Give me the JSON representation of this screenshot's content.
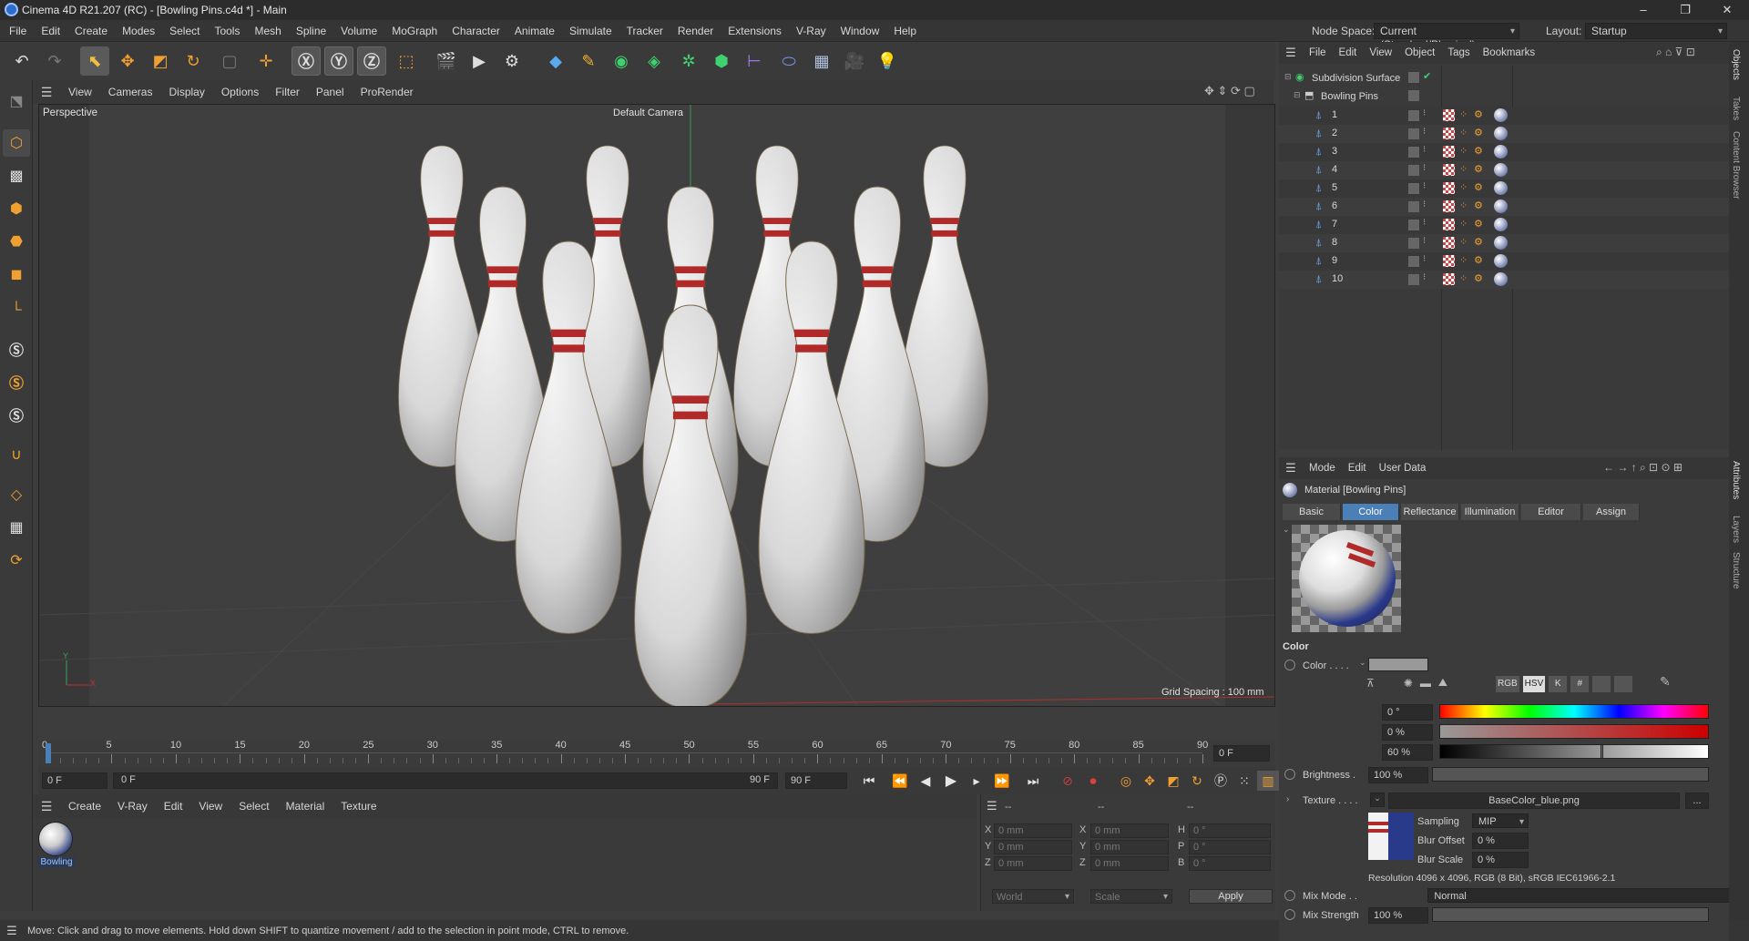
{
  "window": {
    "title": "Cinema 4D R21.207 (RC) - [Bowling Pins.c4d *] - Main",
    "controls": [
      "–",
      "❐",
      "✕"
    ]
  },
  "menubar": {
    "items": [
      "File",
      "Edit",
      "Create",
      "Modes",
      "Select",
      "Tools",
      "Mesh",
      "Spline",
      "Volume",
      "MoGraph",
      "Character",
      "Animate",
      "Simulate",
      "Tracker",
      "Render",
      "Extensions",
      "V-Ray",
      "Window",
      "Help"
    ],
    "node_space_label": "Node Space:",
    "node_space_value": "Current (Standard/Physical)",
    "layout_label": "Layout:",
    "layout_value": "Startup"
  },
  "viewport": {
    "menu": [
      "View",
      "Cameras",
      "Display",
      "Options",
      "Filter",
      "Panel",
      "ProRender"
    ],
    "label": "Perspective",
    "camera": "Default Camera",
    "grid_spacing": "Grid Spacing : 100 mm",
    "axis_y": "Y",
    "axis_x": "X"
  },
  "timeline": {
    "ticks": [
      "0",
      "5",
      "10",
      "15",
      "20",
      "25",
      "30",
      "35",
      "40",
      "45",
      "50",
      "55",
      "60",
      "65",
      "70",
      "75",
      "80",
      "85",
      "90"
    ],
    "current_frame": "0 F",
    "start": "0 F",
    "range_start": "0 F",
    "range_end": "90 F",
    "end": "90 F",
    "end_field": "90 F"
  },
  "material_manager": {
    "menu": [
      "Create",
      "V-Ray",
      "Edit",
      "View",
      "Select",
      "Material",
      "Texture"
    ],
    "materials": [
      {
        "name": "Bowling"
      }
    ]
  },
  "coordinates": {
    "header": [
      "--",
      "--",
      "--"
    ],
    "rows": [
      {
        "l1": "X",
        "v1": "0 mm",
        "l2": "X",
        "v2": "0 mm",
        "l3": "H",
        "v3": "0 °"
      },
      {
        "l1": "Y",
        "v1": "0 mm",
        "l2": "Y",
        "v2": "0 mm",
        "l3": "P",
        "v3": "0 °"
      },
      {
        "l1": "Z",
        "v1": "0 mm",
        "l2": "Z",
        "v2": "0 mm",
        "l3": "B",
        "v3": "0 °"
      }
    ],
    "world": "World",
    "scale": "Scale",
    "apply": "Apply"
  },
  "status": {
    "text": "Move: Click and drag to move elements. Hold down SHIFT to quantize movement / add to the selection in point mode, CTRL to remove."
  },
  "object_manager": {
    "menu": [
      "File",
      "Edit",
      "View",
      "Object",
      "Tags",
      "Bookmarks"
    ],
    "root": "Subdivision Surface",
    "group": "Bowling Pins",
    "children": [
      "1",
      "2",
      "3",
      "4",
      "5",
      "6",
      "7",
      "8",
      "9",
      "10"
    ]
  },
  "attribute_manager": {
    "menu": [
      "Mode",
      "Edit",
      "User Data"
    ],
    "title": "Material [Bowling Pins]",
    "tabs": [
      "Basic",
      "Color",
      "Reflectance",
      "Illumination",
      "Editor",
      "Assign"
    ],
    "active_tab": "Color",
    "section": "Color",
    "color_label": "Color . . . .",
    "h_label": "H",
    "h_value": "0 °",
    "s_label": "S",
    "s_value": "0 %",
    "v_label": "V",
    "v_value": "60 %",
    "v_level": 0.6,
    "brightness_label": "Brightness .",
    "brightness_value": "100 %",
    "texture_label": "Texture . . . .",
    "texture_file": "BaseColor_blue.png",
    "texture_more": "...",
    "sampling_label": "Sampling",
    "sampling_value": "MIP",
    "blur_offset_label": "Blur Offset",
    "blur_offset_value": "0 %",
    "blur_scale_label": "Blur Scale",
    "blur_scale_value": "0 %",
    "resolution": "Resolution 4096 x 4096, RGB (8 Bit), sRGB IEC61966-2.1",
    "mix_mode_label": "Mix Mode . .",
    "mix_mode_value": "Normal",
    "mix_strength_label": "Mix Strength",
    "mix_strength_value": "100 %",
    "color_mode_buttons": [
      "RGB",
      "HSV",
      "K",
      "#"
    ]
  },
  "side_tabs": [
    "Objects",
    "Takes",
    "Content Browser",
    "Attributes",
    "Layers",
    "Structure"
  ],
  "colors": {
    "accent": "#4a7fb8",
    "background": "#3d3d3d",
    "stripe": "#b02a2a"
  }
}
